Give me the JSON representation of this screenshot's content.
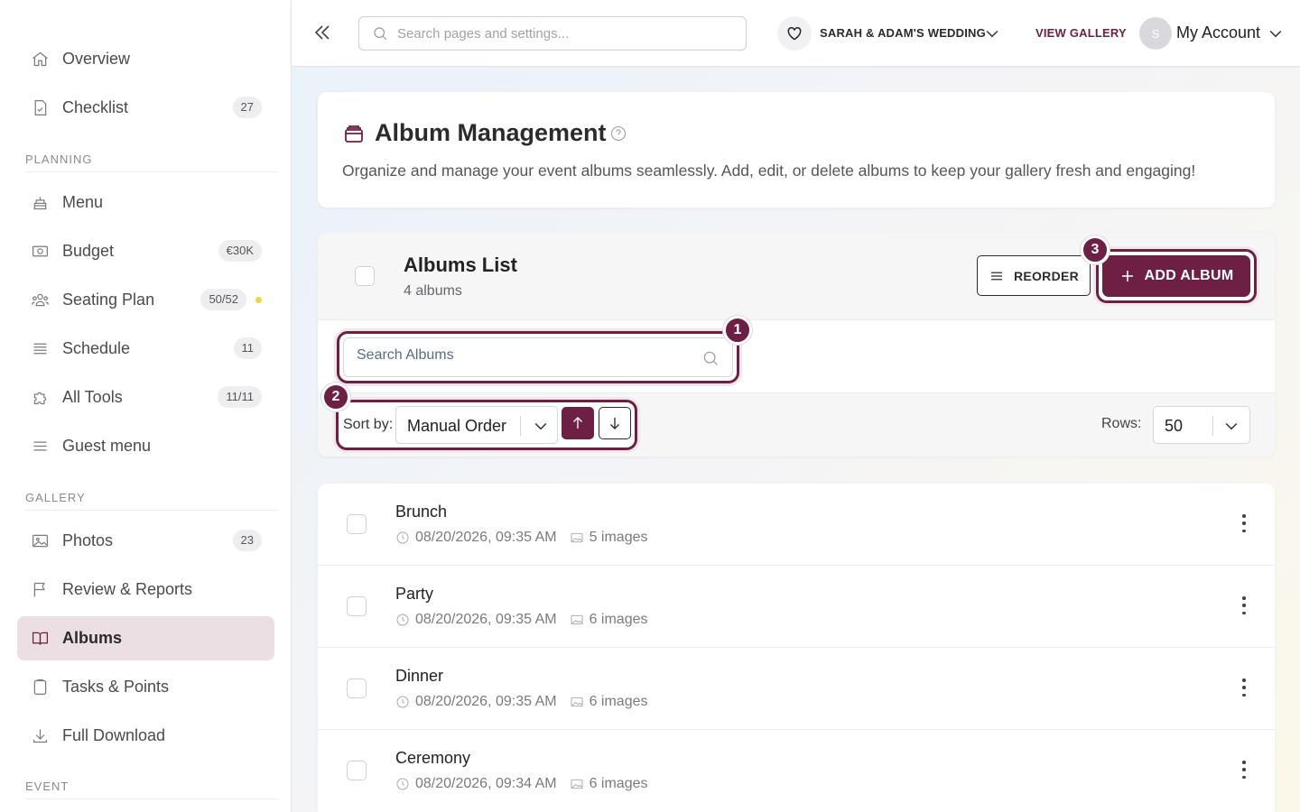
{
  "sidebar": {
    "items": [
      {
        "label": "Overview",
        "icon": "home-icon"
      },
      {
        "label": "Checklist",
        "icon": "checklist-icon",
        "badge": "27"
      },
      {
        "label": "Menu",
        "icon": "cake-icon"
      },
      {
        "label": "Budget",
        "icon": "money-icon",
        "badge": "€30K"
      },
      {
        "label": "Seating Plan",
        "icon": "people-icon",
        "badge": "50/52",
        "dot_color": "#f2d53c"
      },
      {
        "label": "Schedule",
        "icon": "schedule-icon",
        "badge": "11"
      },
      {
        "label": "All Tools",
        "icon": "puzzle-icon",
        "badge": "11/11"
      },
      {
        "label": "Guest menu",
        "icon": "menu-lines-icon"
      },
      {
        "label": "Photos",
        "icon": "image-icon",
        "badge": "23"
      },
      {
        "label": "Review & Reports",
        "icon": "flag-icon"
      },
      {
        "label": "Albums",
        "icon": "book-icon",
        "active": true
      },
      {
        "label": "Tasks & Points",
        "icon": "clipboard-icon"
      },
      {
        "label": "Full Download",
        "icon": "download-icon"
      }
    ],
    "sections": {
      "planning": "PLANNING",
      "gallery": "GALLERY",
      "event": "EVENT"
    }
  },
  "topbar": {
    "search_placeholder": "Search pages and settings...",
    "event_name": "SARAH & ADAM'S WEDDING",
    "view_gallery": "VIEW GALLERY",
    "avatar_initial": "S",
    "account_label": "My Account"
  },
  "header": {
    "title": "Album Management",
    "description": "Organize and manage your event albums seamlessly. Add, edit, or delete albums to keep your gallery fresh and engaging!"
  },
  "albums_panel": {
    "title": "Albums List",
    "count": "4 albums",
    "reorder_label": "REORDER",
    "add_label": "ADD ALBUM",
    "search_placeholder": "Search Albums",
    "sort_label": "Sort by:",
    "sort_value": "Manual Order",
    "rows_label": "Rows:",
    "rows_value": "50",
    "steps": [
      "1",
      "2",
      "3"
    ]
  },
  "albums": [
    {
      "name": "Brunch",
      "date": "08/20/2026, 09:35 AM",
      "images": "5 images"
    },
    {
      "name": "Party",
      "date": "08/20/2026, 09:35 AM",
      "images": "6 images"
    },
    {
      "name": "Dinner",
      "date": "08/20/2026, 09:35 AM",
      "images": "6 images"
    },
    {
      "name": "Ceremony",
      "date": "08/20/2026, 09:34 AM",
      "images": "6 images"
    }
  ],
  "colors": {
    "accent": "#6e1f44",
    "active_bg": "#ecdfe4"
  }
}
